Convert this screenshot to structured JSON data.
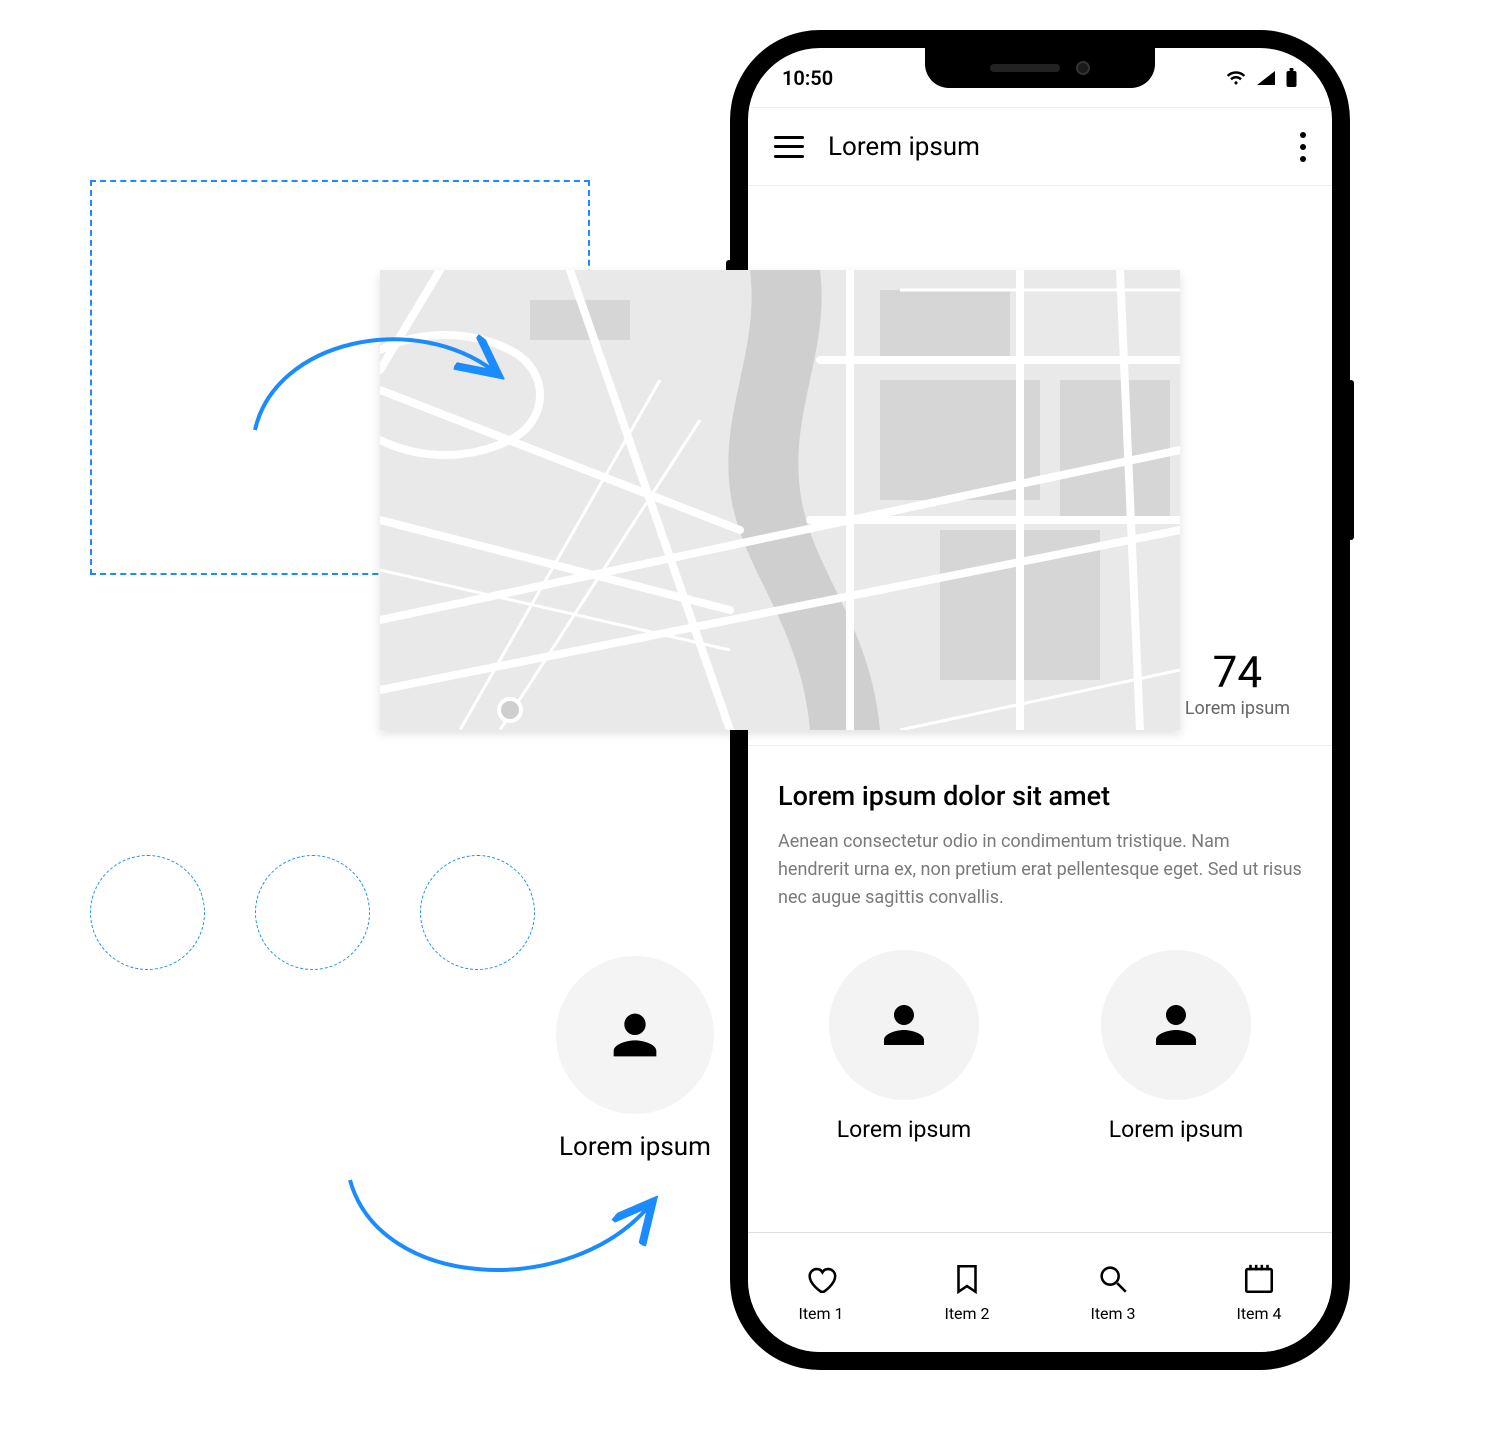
{
  "statusbar": {
    "time": "10:50"
  },
  "header": {
    "title": "Lorem ipsum"
  },
  "stat": {
    "value": "74",
    "caption": "Lorem ipsum"
  },
  "section": {
    "heading": "Lorem ipsum dolor sit amet",
    "body": "Aenean consectetur odio in condimentum tristique. Nam hendrerit urna ex, non pretium erat pellentesque eget. Sed ut risus nec augue sagittis convallis."
  },
  "avatars_inside": [
    {
      "label": "Lorem ipsum"
    },
    {
      "label": "Lorem ipsum"
    }
  ],
  "avatar_outside": {
    "label": "Lorem ipsum"
  },
  "bottom_nav": [
    {
      "label": "Item 1"
    },
    {
      "label": "Item 2"
    },
    {
      "label": "Item 3"
    },
    {
      "label": "Item 4"
    }
  ],
  "colors": {
    "accent": "#1a8cff"
  }
}
